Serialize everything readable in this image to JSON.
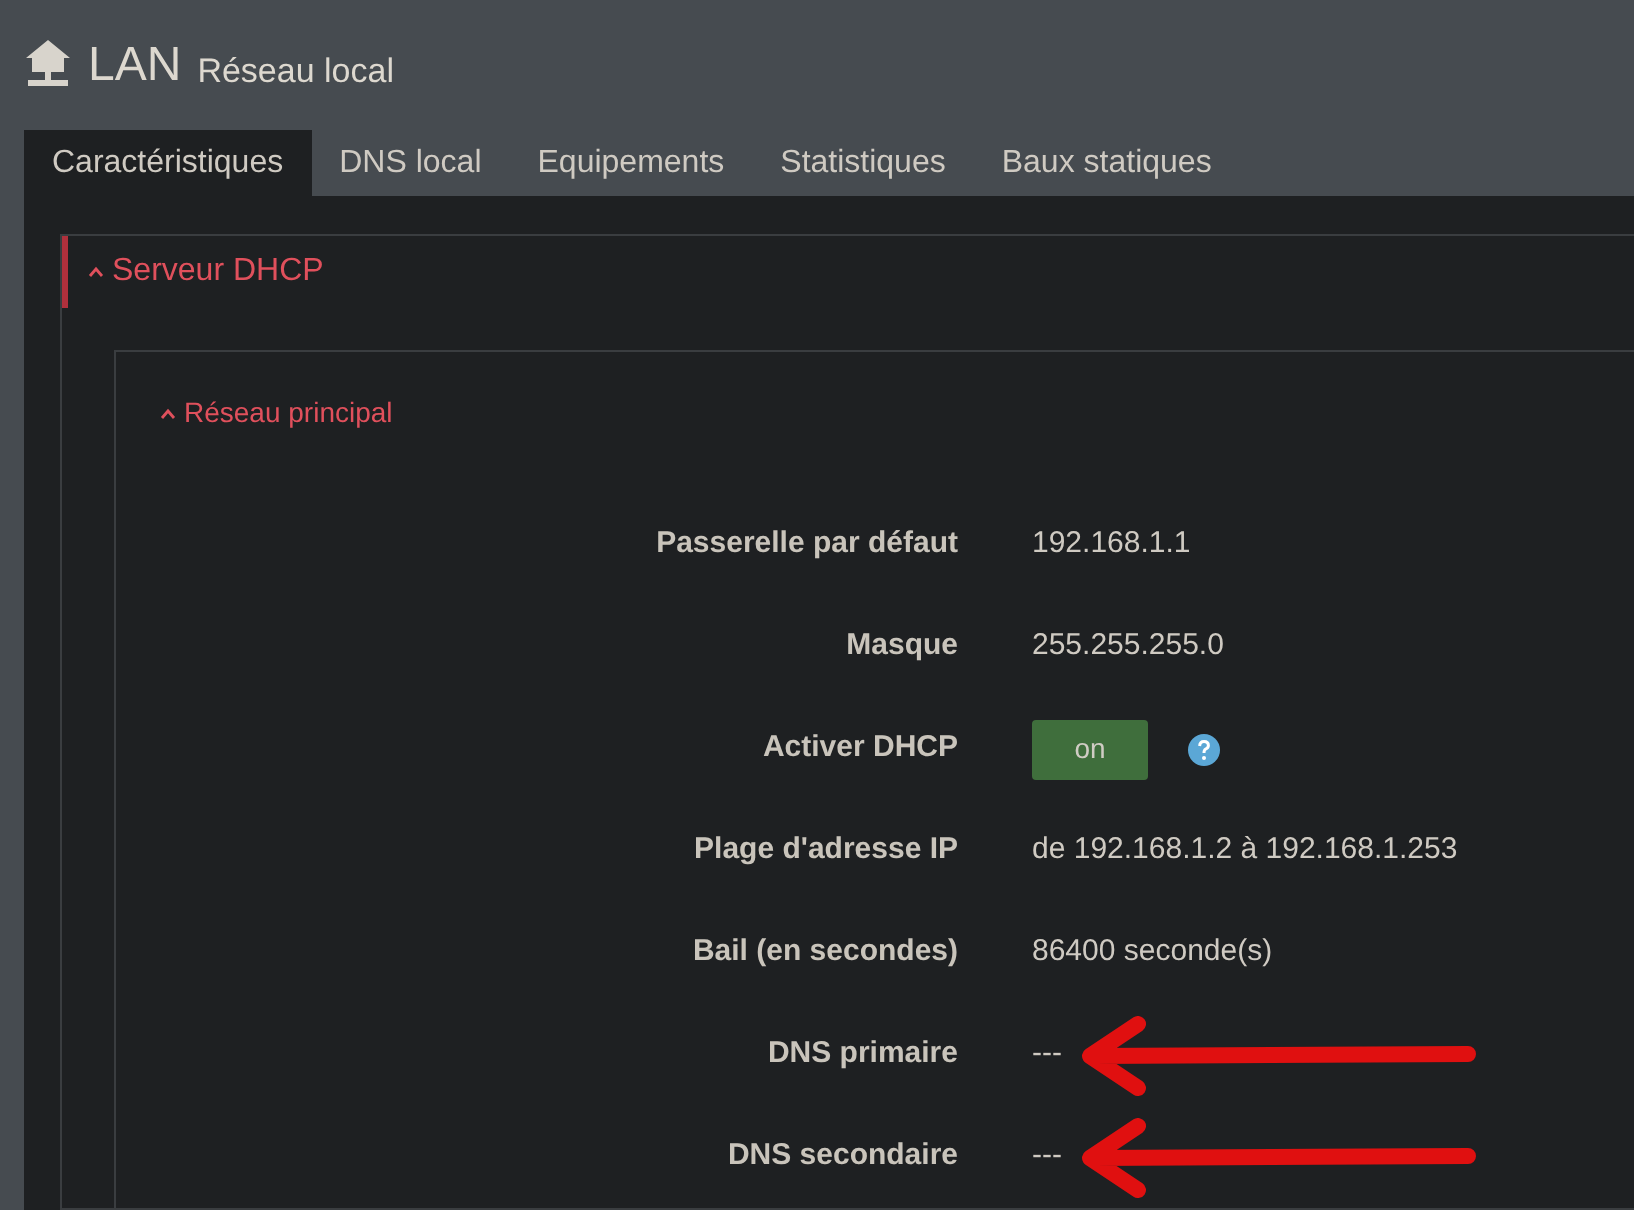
{
  "page": {
    "title": "LAN",
    "subtitle": "Réseau local"
  },
  "tabs": [
    {
      "label": "Caractéristiques",
      "selected": true
    },
    {
      "label": "DNS local",
      "selected": false
    },
    {
      "label": "Equipements",
      "selected": false
    },
    {
      "label": "Statistiques",
      "selected": false
    },
    {
      "label": "Baux statiques",
      "selected": false
    }
  ],
  "section": {
    "title": "Serveur DHCP",
    "expanded": true,
    "subsection": {
      "title": "Réseau principal",
      "expanded": true,
      "rows": [
        {
          "kind": "text",
          "label": "Passerelle par défaut",
          "value": "192.168.1.1",
          "arrow": false
        },
        {
          "kind": "text",
          "label": "Masque",
          "value": "255.255.255.0",
          "arrow": false
        },
        {
          "kind": "toggle",
          "label": "Activer DHCP",
          "value": "on",
          "on": true,
          "help": true,
          "arrow": false
        },
        {
          "kind": "text",
          "label": "Plage d'adresse IP",
          "value": "de 192.168.1.2 à 192.168.1.253",
          "arrow": false
        },
        {
          "kind": "text",
          "label": "Bail (en secondes)",
          "value": "86400 seconde(s)",
          "arrow": false
        },
        {
          "kind": "text",
          "label": "DNS primaire",
          "value": "---",
          "arrow": true
        },
        {
          "kind": "text",
          "label": "DNS secondaire",
          "value": "---",
          "arrow": true
        }
      ]
    }
  }
}
